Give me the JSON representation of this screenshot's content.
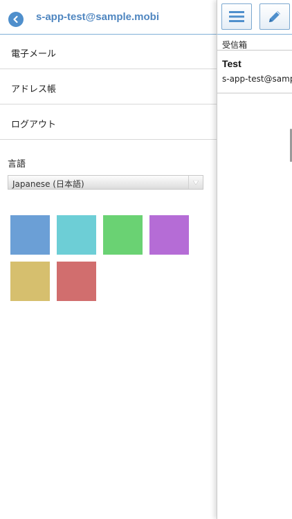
{
  "header": {
    "back_icon": "chevron-left-icon",
    "title": "s-app-test@sample.mobi",
    "accent_color": "#4f86c0"
  },
  "menu": {
    "items": [
      {
        "label": "電子メール"
      },
      {
        "label": "アドレス帳"
      },
      {
        "label": "ログアウト"
      }
    ]
  },
  "language": {
    "label": "言語",
    "selected": "Japanese (日本語)"
  },
  "themes": {
    "colors": [
      "#6b9fd6",
      "#6dced6",
      "#6ad273",
      "#b56cd6",
      "#d6bf6e",
      "#d16e6e"
    ]
  },
  "toolbar": {
    "menu_icon": "hamburger-menu-icon",
    "compose_icon": "pencil-icon"
  },
  "mailbox": {
    "folder": "受信箱",
    "messages": [
      {
        "subject": "Test",
        "from": "s-app-test@sample.mobi"
      }
    ]
  }
}
